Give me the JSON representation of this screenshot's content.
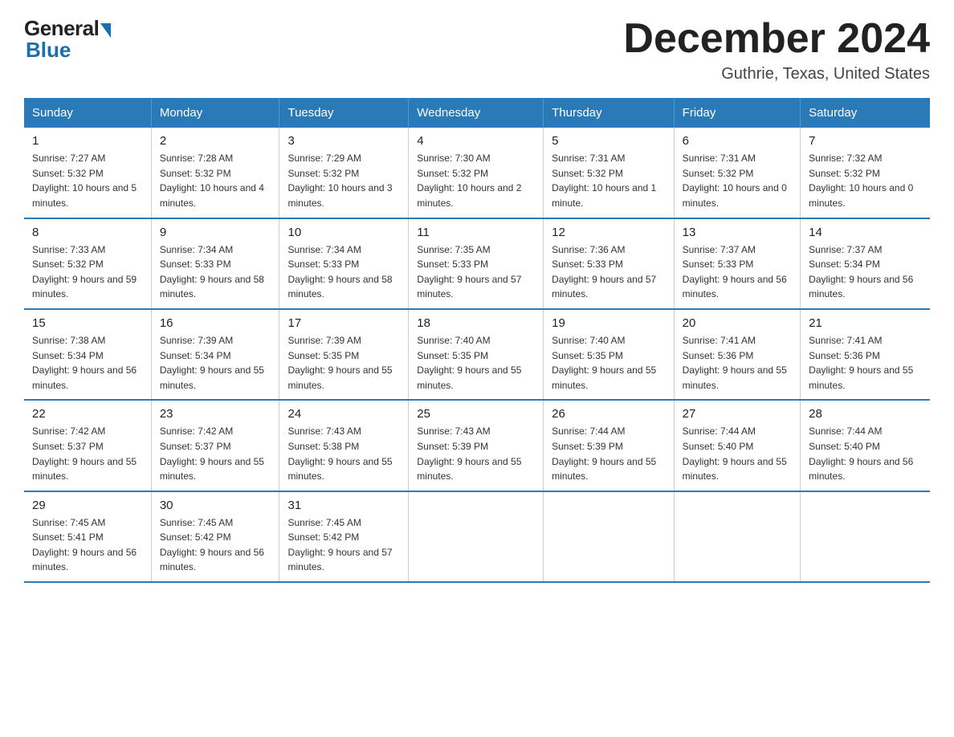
{
  "logo": {
    "general": "General",
    "blue": "Blue"
  },
  "title": "December 2024",
  "location": "Guthrie, Texas, United States",
  "headers": [
    "Sunday",
    "Monday",
    "Tuesday",
    "Wednesday",
    "Thursday",
    "Friday",
    "Saturday"
  ],
  "weeks": [
    [
      {
        "day": "1",
        "sunrise": "7:27 AM",
        "sunset": "5:32 PM",
        "daylight": "10 hours and 5 minutes."
      },
      {
        "day": "2",
        "sunrise": "7:28 AM",
        "sunset": "5:32 PM",
        "daylight": "10 hours and 4 minutes."
      },
      {
        "day": "3",
        "sunrise": "7:29 AM",
        "sunset": "5:32 PM",
        "daylight": "10 hours and 3 minutes."
      },
      {
        "day": "4",
        "sunrise": "7:30 AM",
        "sunset": "5:32 PM",
        "daylight": "10 hours and 2 minutes."
      },
      {
        "day": "5",
        "sunrise": "7:31 AM",
        "sunset": "5:32 PM",
        "daylight": "10 hours and 1 minute."
      },
      {
        "day": "6",
        "sunrise": "7:31 AM",
        "sunset": "5:32 PM",
        "daylight": "10 hours and 0 minutes."
      },
      {
        "day": "7",
        "sunrise": "7:32 AM",
        "sunset": "5:32 PM",
        "daylight": "10 hours and 0 minutes."
      }
    ],
    [
      {
        "day": "8",
        "sunrise": "7:33 AM",
        "sunset": "5:32 PM",
        "daylight": "9 hours and 59 minutes."
      },
      {
        "day": "9",
        "sunrise": "7:34 AM",
        "sunset": "5:33 PM",
        "daylight": "9 hours and 58 minutes."
      },
      {
        "day": "10",
        "sunrise": "7:34 AM",
        "sunset": "5:33 PM",
        "daylight": "9 hours and 58 minutes."
      },
      {
        "day": "11",
        "sunrise": "7:35 AM",
        "sunset": "5:33 PM",
        "daylight": "9 hours and 57 minutes."
      },
      {
        "day": "12",
        "sunrise": "7:36 AM",
        "sunset": "5:33 PM",
        "daylight": "9 hours and 57 minutes."
      },
      {
        "day": "13",
        "sunrise": "7:37 AM",
        "sunset": "5:33 PM",
        "daylight": "9 hours and 56 minutes."
      },
      {
        "day": "14",
        "sunrise": "7:37 AM",
        "sunset": "5:34 PM",
        "daylight": "9 hours and 56 minutes."
      }
    ],
    [
      {
        "day": "15",
        "sunrise": "7:38 AM",
        "sunset": "5:34 PM",
        "daylight": "9 hours and 56 minutes."
      },
      {
        "day": "16",
        "sunrise": "7:39 AM",
        "sunset": "5:34 PM",
        "daylight": "9 hours and 55 minutes."
      },
      {
        "day": "17",
        "sunrise": "7:39 AM",
        "sunset": "5:35 PM",
        "daylight": "9 hours and 55 minutes."
      },
      {
        "day": "18",
        "sunrise": "7:40 AM",
        "sunset": "5:35 PM",
        "daylight": "9 hours and 55 minutes."
      },
      {
        "day": "19",
        "sunrise": "7:40 AM",
        "sunset": "5:35 PM",
        "daylight": "9 hours and 55 minutes."
      },
      {
        "day": "20",
        "sunrise": "7:41 AM",
        "sunset": "5:36 PM",
        "daylight": "9 hours and 55 minutes."
      },
      {
        "day": "21",
        "sunrise": "7:41 AM",
        "sunset": "5:36 PM",
        "daylight": "9 hours and 55 minutes."
      }
    ],
    [
      {
        "day": "22",
        "sunrise": "7:42 AM",
        "sunset": "5:37 PM",
        "daylight": "9 hours and 55 minutes."
      },
      {
        "day": "23",
        "sunrise": "7:42 AM",
        "sunset": "5:37 PM",
        "daylight": "9 hours and 55 minutes."
      },
      {
        "day": "24",
        "sunrise": "7:43 AM",
        "sunset": "5:38 PM",
        "daylight": "9 hours and 55 minutes."
      },
      {
        "day": "25",
        "sunrise": "7:43 AM",
        "sunset": "5:39 PM",
        "daylight": "9 hours and 55 minutes."
      },
      {
        "day": "26",
        "sunrise": "7:44 AM",
        "sunset": "5:39 PM",
        "daylight": "9 hours and 55 minutes."
      },
      {
        "day": "27",
        "sunrise": "7:44 AM",
        "sunset": "5:40 PM",
        "daylight": "9 hours and 55 minutes."
      },
      {
        "day": "28",
        "sunrise": "7:44 AM",
        "sunset": "5:40 PM",
        "daylight": "9 hours and 56 minutes."
      }
    ],
    [
      {
        "day": "29",
        "sunrise": "7:45 AM",
        "sunset": "5:41 PM",
        "daylight": "9 hours and 56 minutes."
      },
      {
        "day": "30",
        "sunrise": "7:45 AM",
        "sunset": "5:42 PM",
        "daylight": "9 hours and 56 minutes."
      },
      {
        "day": "31",
        "sunrise": "7:45 AM",
        "sunset": "5:42 PM",
        "daylight": "9 hours and 57 minutes."
      },
      null,
      null,
      null,
      null
    ]
  ]
}
